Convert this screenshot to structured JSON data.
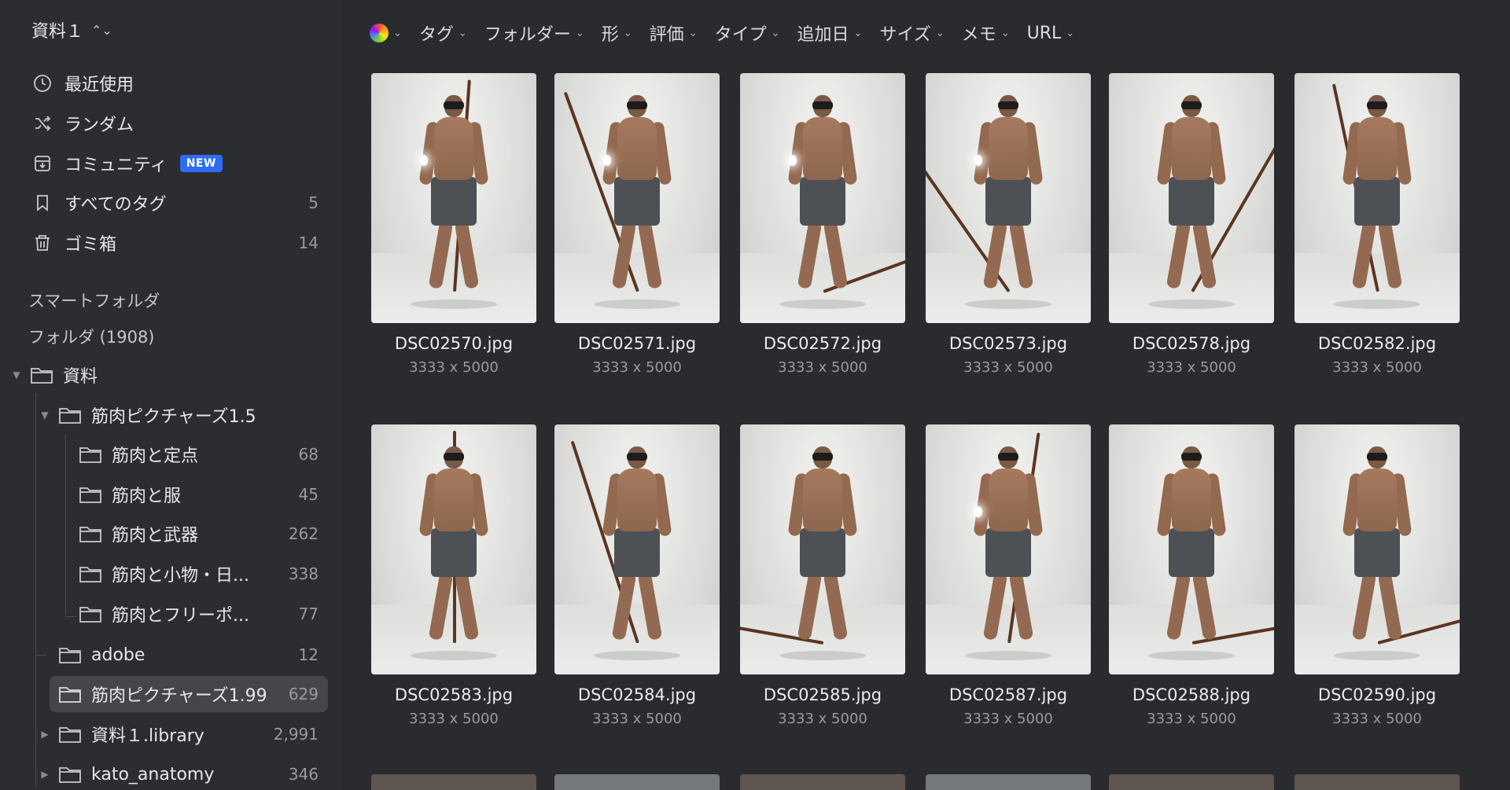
{
  "sidebar": {
    "library_name": "資料１",
    "nav": [
      {
        "label": "最近使用",
        "icon": "clock-icon",
        "count": ""
      },
      {
        "label": "ランダム",
        "icon": "shuffle-icon",
        "count": ""
      },
      {
        "label": "コミュニティ",
        "icon": "download-box-icon",
        "count": "",
        "badge": "NEW"
      },
      {
        "label": "すべてのタグ",
        "icon": "bookmark-icon",
        "count": "5"
      },
      {
        "label": "ゴミ箱",
        "icon": "trash-icon",
        "count": "14"
      }
    ],
    "smart_folders_label": "スマートフォルダ",
    "folders_label": "フォルダ (1908)",
    "tree": [
      {
        "label": "資料",
        "count": "",
        "level": 0,
        "expanded": true
      },
      {
        "label": "筋肉ピクチャーズ1.5",
        "count": "",
        "level": 1,
        "expanded": true
      },
      {
        "label": "筋肉と定点",
        "count": "68",
        "level": 2
      },
      {
        "label": "筋肉と服",
        "count": "45",
        "level": 2
      },
      {
        "label": "筋肉と武器",
        "count": "262",
        "level": 2
      },
      {
        "label": "筋肉と小物・日...",
        "count": "338",
        "level": 2
      },
      {
        "label": "筋肉とフリーポ...",
        "count": "77",
        "level": 2
      },
      {
        "label": "adobe",
        "count": "12",
        "level": 1
      },
      {
        "label": "筋肉ピクチャーズ1.99",
        "count": "629",
        "level": 1,
        "selected": true
      },
      {
        "label": "資料１.library",
        "count": "2,991",
        "level": 1,
        "collapsed": true
      },
      {
        "label": "kato_anatomy",
        "count": "346",
        "level": 1,
        "collapsed": true
      }
    ]
  },
  "toolbar": {
    "filters": [
      "タグ",
      "フォルダー",
      "形",
      "評価",
      "タイプ",
      "追加日",
      "サイズ",
      "メモ",
      "URL"
    ]
  },
  "items": [
    {
      "name": "DSC02570.jpg",
      "dims": "3333 x 5000",
      "pose": 4
    },
    {
      "name": "DSC02571.jpg",
      "dims": "3333 x 5000",
      "pose": -20
    },
    {
      "name": "DSC02572.jpg",
      "dims": "3333 x 5000",
      "pose": 70
    },
    {
      "name": "DSC02573.jpg",
      "dims": "3333 x 5000",
      "pose": -35
    },
    {
      "name": "DSC02578.jpg",
      "dims": "3333 x 5000",
      "pose": 30
    },
    {
      "name": "DSC02582.jpg",
      "dims": "3333 x 5000",
      "pose": -12
    },
    {
      "name": "DSC02583.jpg",
      "dims": "3333 x 5000",
      "pose": 0
    },
    {
      "name": "DSC02584.jpg",
      "dims": "3333 x 5000",
      "pose": -18
    },
    {
      "name": "DSC02585.jpg",
      "dims": "3333 x 5000",
      "pose": -80
    },
    {
      "name": "DSC02587.jpg",
      "dims": "3333 x 5000",
      "pose": 8
    },
    {
      "name": "DSC02588.jpg",
      "dims": "3333 x 5000",
      "pose": 80
    },
    {
      "name": "DSC02590.jpg",
      "dims": "3333 x 5000",
      "pose": 75
    }
  ]
}
